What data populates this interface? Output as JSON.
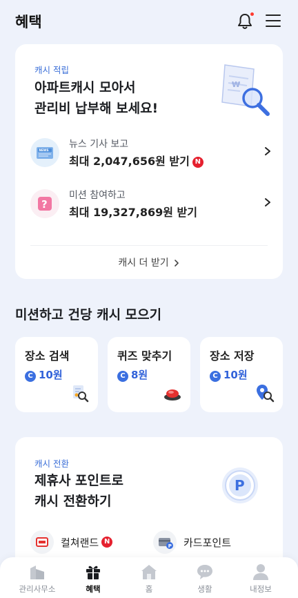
{
  "header": {
    "title": "혜택"
  },
  "cash_card": {
    "eyebrow": "캐시 적립",
    "headline_line1": "아파트캐시 모아서",
    "headline_line2": "관리비 납부해 보세요!",
    "rows": [
      {
        "label": "뉴스 기사 보고",
        "value": "최대 2,047,656원 받기",
        "badge": "N",
        "icon": "news-icon"
      },
      {
        "label": "미션 참여하고",
        "value": "최대 19,327,869원 받기",
        "icon": "question-icon"
      }
    ],
    "more_label": "캐시 더 받기"
  },
  "missions": {
    "title": "미션하고 건당 캐시 모으기",
    "coin_symbol": "C",
    "items": [
      {
        "title": "장소 검색",
        "reward": "10원",
        "icon": "map-search-icon"
      },
      {
        "title": "퀴즈 맞추기",
        "reward": "8원",
        "icon": "buzzer-icon"
      },
      {
        "title": "장소 저장",
        "reward": "10원",
        "icon": "pin-search-icon"
      }
    ]
  },
  "conversion_card": {
    "eyebrow": "캐시 전환",
    "headline_line1": "제휴사 포인트로",
    "headline_line2": "캐시 전환하기",
    "partners": [
      {
        "label": "컬쳐랜드",
        "badge": "N",
        "icon": "cultureland-icon"
      },
      {
        "label": "카드포인트",
        "icon": "card-point-icon"
      }
    ]
  },
  "bottom_nav": {
    "items": [
      {
        "label": "관리사무소",
        "icon": "building-icon",
        "active": false
      },
      {
        "label": "혜택",
        "icon": "gift-icon",
        "active": true
      },
      {
        "label": "홈",
        "icon": "home-icon",
        "active": false
      },
      {
        "label": "생활",
        "icon": "chat-icon",
        "active": false
      },
      {
        "label": "내정보",
        "icon": "person-icon",
        "active": false
      }
    ]
  },
  "colors": {
    "accent": "#3162d9",
    "background": "#eef2fb",
    "badge_red": "#e5202e"
  }
}
